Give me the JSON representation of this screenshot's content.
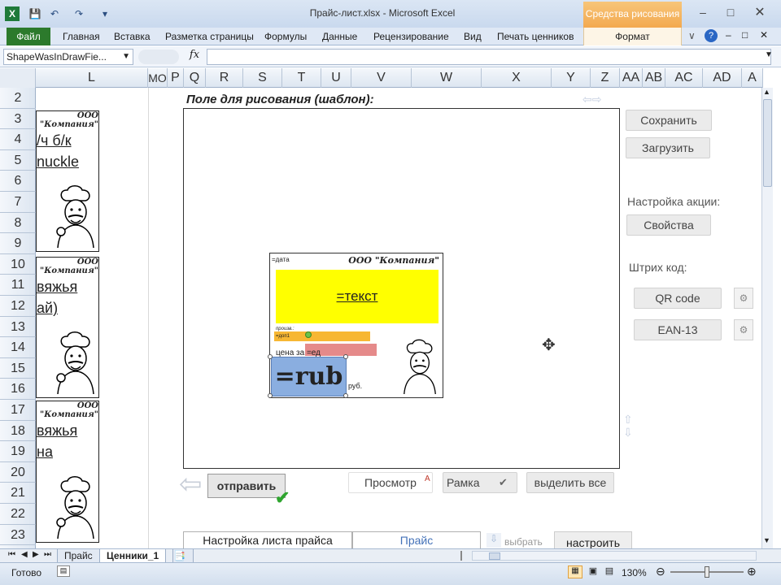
{
  "window": {
    "title": "Прайс-лист.xlsx - Microsoft Excel",
    "context_tab": "Средства рисования"
  },
  "ribbon": {
    "tabs": [
      "Файл",
      "Главная",
      "Вставка",
      "Разметка страницы",
      "Формулы",
      "Данные",
      "Рецензирование",
      "Вид",
      "Печать ценников",
      "Формат"
    ]
  },
  "formula_bar": {
    "name_box": "ShapeWasInDrawFie...",
    "fx": "fx",
    "formula": ""
  },
  "columns": [
    "L",
    "МО",
    "P",
    "Q",
    "R",
    "S",
    "T",
    "U",
    "V",
    "W",
    "X",
    "Y",
    "Z",
    "AA",
    "AB",
    "AC",
    "AD",
    "A"
  ],
  "rows": [
    "2",
    "3",
    "4",
    "5",
    "6",
    "7",
    "8",
    "9",
    "10",
    "11",
    "12",
    "13",
    "14",
    "15",
    "16",
    "17",
    "18",
    "19",
    "20",
    "21",
    "22",
    "23"
  ],
  "cards": [
    {
      "company": "ООО \"Компания\"",
      "line1": "/ч б/к",
      "line2": "nuckle"
    },
    {
      "company": "ООО \"Компания\"",
      "line1": "вяжья",
      "line2": "ай)"
    },
    {
      "company": "ООО \"Компания\"",
      "line1": "вяжья",
      "line2": "на"
    }
  ],
  "canvas": {
    "title": "Поле для рисования (шаблон):",
    "template": {
      "date": "=дата",
      "company": "ООО \"Компания\"",
      "text": "=текст",
      "small1": "произв.:",
      "small2": "=доп1",
      "price_per_unit": "цена за ",
      "unit": "=ед",
      "rub": "=rub",
      "currency": "руб."
    }
  },
  "buttons": {
    "save": "Сохранить",
    "load": "Загрузить",
    "promo_label": "Настройка акции:",
    "properties": "Свойства",
    "barcode_label": "Штрих код:",
    "qr": "QR code",
    "ean": "EAN-13",
    "send": "отправить",
    "preview": "Просмотр",
    "frame": "Рамка",
    "select_all": "выделить все",
    "sheet_setup": "Настройка листа прайса",
    "price": "Прайс",
    "choose": "выбрать",
    "configure": "настроить"
  },
  "sheet_tabs": [
    "Прайс",
    "Ценники_1"
  ],
  "status": {
    "ready": "Готово",
    "zoom": "130%"
  },
  "colors": {
    "file_tab": "#2c7a2c",
    "context_tab": "#f3a94f",
    "yellow": "#ffff00",
    "orange_bar": "#f7b733",
    "pink_bar": "#e58a8a",
    "blue_box": "#8aaee0"
  }
}
